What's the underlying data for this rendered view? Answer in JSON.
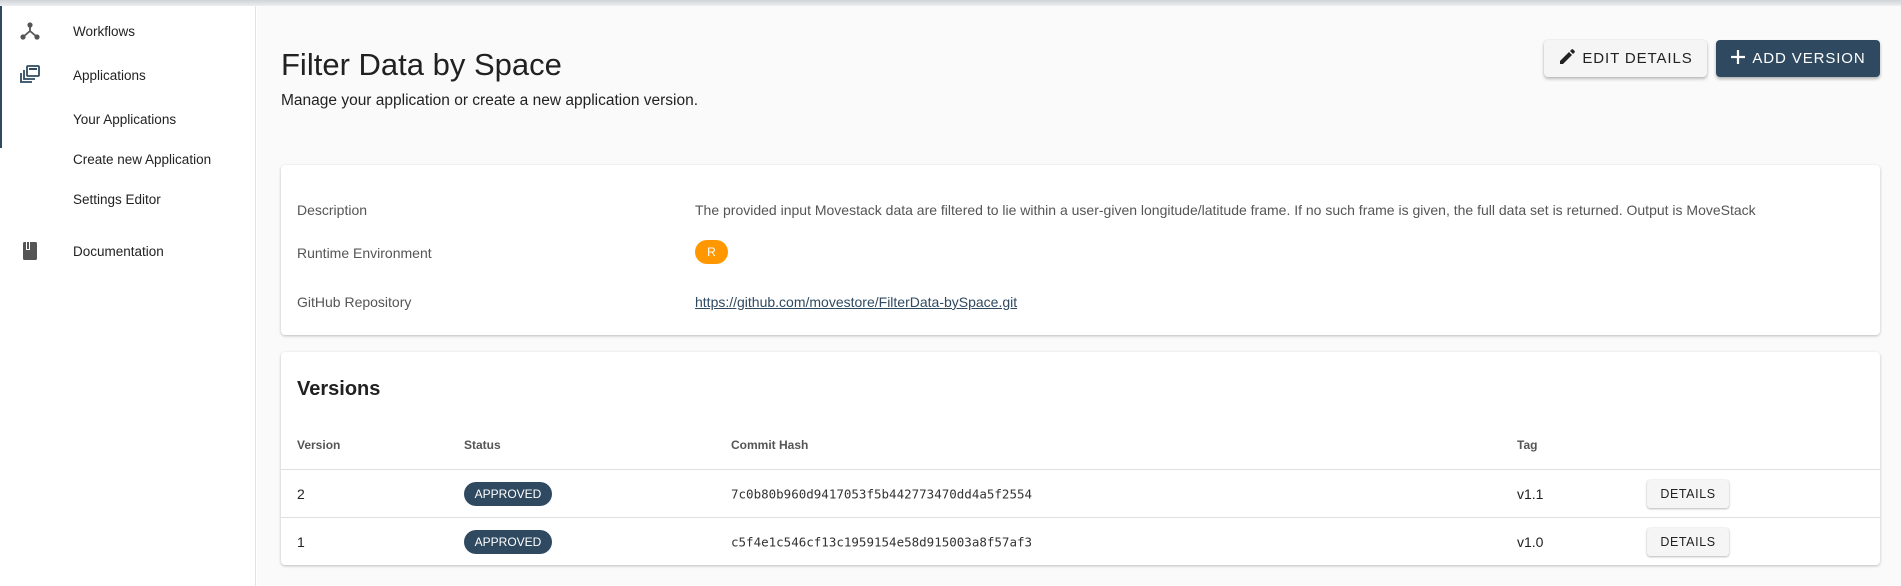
{
  "sidebar": {
    "items": [
      {
        "label": "Workflows",
        "icon": "workflow-icon"
      },
      {
        "label": "Applications",
        "icon": "applications-icon"
      },
      {
        "label": "Your Applications"
      },
      {
        "label": "Create new Application"
      },
      {
        "label": "Settings Editor"
      },
      {
        "label": "Documentation",
        "icon": "book-icon"
      }
    ]
  },
  "header": {
    "title": "Filter Data by Space",
    "subtitle": "Manage your application or create a new application version.",
    "edit_label": "EDIT DETAILS",
    "add_label": "ADD VERSION"
  },
  "details": {
    "description_label": "Description",
    "description_value": "The provided input Movestack data are filtered to lie within a user-given longitude/latitude frame. If no such frame is given, the full data set is returned. Output is MoveStack",
    "runtime_label": "Runtime Environment",
    "runtime_value": "R",
    "repo_label": "GitHub Repository",
    "repo_value": "https://github.com/movestore/FilterData-bySpace.git"
  },
  "versions": {
    "title": "Versions",
    "columns": [
      "Version",
      "Status",
      "Commit Hash",
      "Tag"
    ],
    "rows": [
      {
        "version": "2",
        "status": "APPROVED",
        "hash": "7c0b80b960d9417053f5b442773470dd4a5f2554",
        "tag": "v1.1",
        "action": "DETAILS"
      },
      {
        "version": "1",
        "status": "APPROVED",
        "hash": "c5f4e1c546cf13c1959154e58d915003a8f57af3",
        "tag": "v1.0",
        "action": "DETAILS"
      }
    ]
  },
  "colors": {
    "primary": "#2f4a60",
    "runtime_chip": "#ff9800"
  }
}
